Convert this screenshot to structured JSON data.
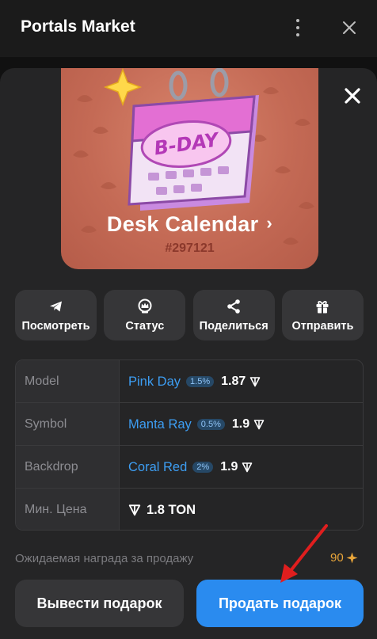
{
  "app": {
    "title": "Portals Market"
  },
  "gift": {
    "name": "Desk Calendar",
    "number": "#297121",
    "art_text": "B-DAY"
  },
  "actions": [
    {
      "label": "Посмотреть",
      "icon": "telegram-icon"
    },
    {
      "label": "Статус",
      "icon": "crown-icon"
    },
    {
      "label": "Поделиться",
      "icon": "share-icon"
    },
    {
      "label": "Отправить",
      "icon": "gift-icon"
    }
  ],
  "attributes": [
    {
      "key": "Model",
      "value": "Pink Day",
      "rarity": "1.5%",
      "price": "1.87"
    },
    {
      "key": "Symbol",
      "value": "Manta Ray",
      "rarity": "0.5%",
      "price": "1.9"
    },
    {
      "key": "Backdrop",
      "value": "Coral Red",
      "rarity": "2%",
      "price": "1.9"
    }
  ],
  "min_price": {
    "key": "Мин. Цена",
    "value": "1.8 TON"
  },
  "reward": {
    "label": "Ожидаемая награда за продажу",
    "value": "90"
  },
  "buttons": {
    "withdraw": "Вывести подарок",
    "sell": "Продать подарок"
  },
  "colors": {
    "accent": "#2a8bef",
    "link": "#3d9ef3",
    "reward": "#e8a53a",
    "hero_bg": "#c46a55",
    "annotation_arrow": "#e01e1e"
  }
}
